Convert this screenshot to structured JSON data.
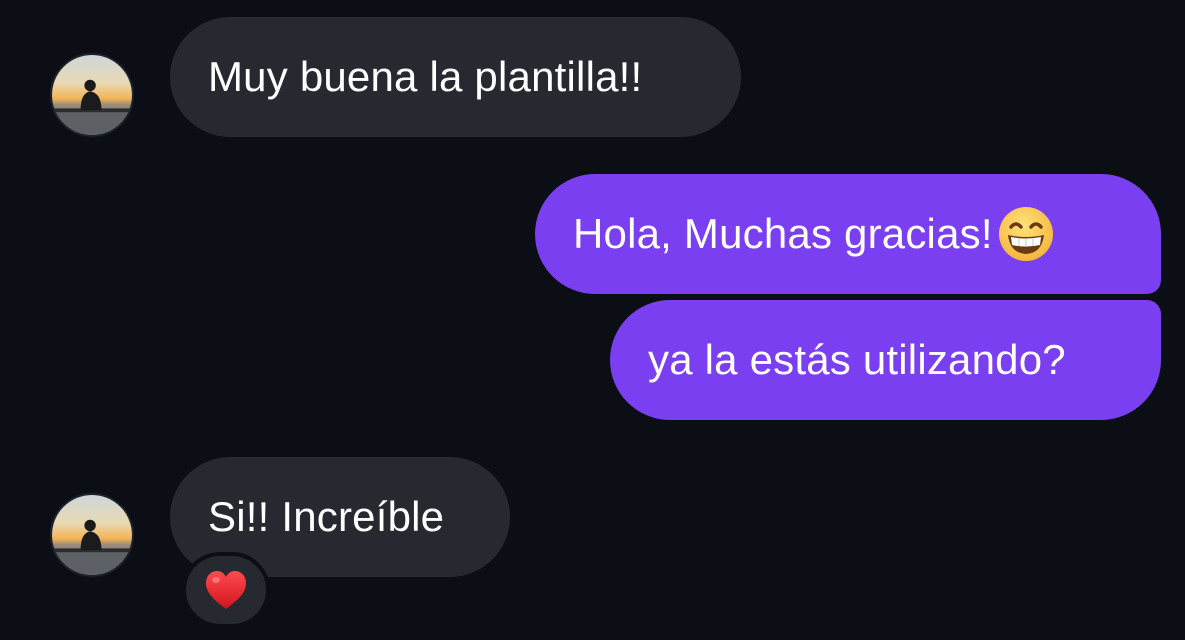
{
  "messages": [
    {
      "sender": "other",
      "text": "Muy buena la plantilla!!"
    },
    {
      "sender": "me",
      "text": "Hola, Muchas gracias!",
      "emoji": "grinning-face-with-smiling-eyes"
    },
    {
      "sender": "me",
      "text": "ya la estás utilizando?"
    },
    {
      "sender": "other",
      "text": "Si!! Increíble",
      "reaction": "red-heart"
    }
  ],
  "colors": {
    "background": "#0b0e15",
    "incoming_bubble": "#262a30",
    "outgoing_bubble": "#7a3ff0",
    "text": "#ffffff",
    "heart": "#e8202a"
  },
  "icons": {
    "avatar": "sunset-silhouette-avatar",
    "emoji": "grinning-face-emoji",
    "reaction": "heart-icon"
  }
}
